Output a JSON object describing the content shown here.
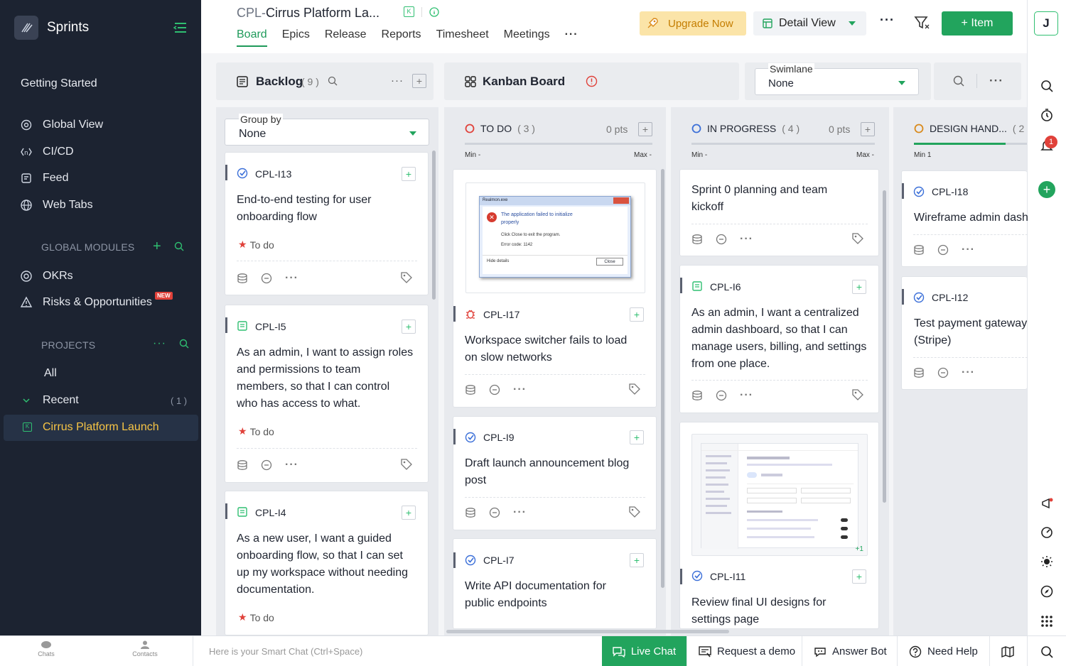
{
  "sidebar": {
    "brand": "Sprints",
    "getting_started": "Getting Started",
    "items": [
      {
        "label": "Global View",
        "icon": "eye-icon"
      },
      {
        "label": "CI/CD",
        "icon": "code-icon"
      },
      {
        "label": "Feed",
        "icon": "feed-icon"
      },
      {
        "label": "Web Tabs",
        "icon": "globe-icon"
      }
    ],
    "global_modules_label": "GLOBAL MODULES",
    "modules": [
      {
        "label": "OKRs",
        "icon": "target-icon"
      },
      {
        "label": "Risks & Opportunities",
        "icon": "warning-icon",
        "badge": "NEW"
      }
    ],
    "projects_label": "PROJECTS",
    "all": "All",
    "recent": "Recent",
    "recent_count": "( 1 )",
    "active_project": "Cirrus Platform Launch",
    "active_project_key": "K"
  },
  "header": {
    "title_prefix": "CPL-",
    "title": "Cirrus Platform La...",
    "tabs": [
      "Board",
      "Epics",
      "Release",
      "Reports",
      "Timesheet",
      "Meetings"
    ],
    "active_tab": "Board",
    "upgrade": "Upgrade Now",
    "view": "Detail View",
    "add_item": "+ Item"
  },
  "backlog": {
    "title": "Backlog",
    "count": "( 9 )",
    "group_by_label": "Group by",
    "group_by_value": "None",
    "cards": [
      {
        "id": "CPL-I13",
        "title_lines": [
          "End-to-end testing for user",
          "onboarding flow"
        ],
        "status": "To do",
        "type": "task"
      },
      {
        "id": "CPL-I5",
        "title_lines": [
          "As an admin, I want to assign roles",
          "and permissions to team",
          "members, so that I can control",
          "who has access to what."
        ],
        "status": "To do",
        "type": "story"
      },
      {
        "id": "CPL-I4",
        "title_lines": [
          "As a new user, I want a guided",
          "onboarding flow, so that I can set",
          "up my workspace without needing",
          "documentation."
        ],
        "status": "To do",
        "type": "story"
      }
    ]
  },
  "kanban": {
    "title": "Kanban Board",
    "swimlane_label": "Swimlane",
    "swimlane_value": "None",
    "columns": [
      {
        "name": "TO DO",
        "count": "( 3 )",
        "pts": "0 pts",
        "min": "Min -",
        "max": "Max -",
        "color": "#e0413a"
      },
      {
        "name": "IN PROGRESS",
        "count": "( 4 )",
        "pts": "0 pts",
        "min": "Min -",
        "max": "Max -",
        "color": "#3b6fd8"
      },
      {
        "name": "DESIGN HAND...",
        "count": "( 2",
        "pts": "",
        "min": "Min 1",
        "max": "",
        "color": "#d98a1c"
      }
    ],
    "todo_cards": [
      {
        "id": "CPL-I17",
        "title_lines": [
          "Workspace switcher fails to load",
          "on slow networks"
        ],
        "type": "bug",
        "thumb": {
          "window_title": "Realmon.exe",
          "line1": "The application failed to initialize",
          "line2": "properly",
          "line3": "Click Close to exit the program.",
          "line4": "Error code: 1142",
          "hide": "Hide details",
          "close": "Close"
        }
      },
      {
        "id": "CPL-I9",
        "title_lines": [
          "Draft launch announcement blog",
          "post"
        ],
        "type": "task"
      },
      {
        "id": "CPL-I7",
        "title_lines": [
          "Write API documentation for",
          "public endpoints"
        ],
        "type": "task"
      }
    ],
    "progress_cards": [
      {
        "id": "",
        "title_lines": [
          "Sprint 0 planning and team",
          "kickoff"
        ],
        "type": "task"
      },
      {
        "id": "CPL-I6",
        "title_lines": [
          "As an admin, I want a centralized",
          "admin dashboard, so that I can",
          "manage users, billing, and settings",
          "from one place."
        ],
        "type": "story"
      },
      {
        "id": "CPL-I11",
        "title_lines": [
          "Review final UI designs for",
          "settings page"
        ],
        "type": "task",
        "extra": "+1"
      }
    ],
    "design_cards": [
      {
        "id": "CPL-I18",
        "title_lines": [
          "Wireframe admin dash"
        ],
        "type": "task"
      },
      {
        "id": "CPL-I12",
        "title_lines": [
          "Test payment gateway",
          "(Stripe)"
        ],
        "type": "task"
      }
    ]
  },
  "rail": {
    "avatar": "J",
    "notif_count": "1"
  },
  "bottom": {
    "chats": "Chats",
    "contacts": "Contacts",
    "smart_chat_placeholder": "Here is your Smart Chat (Ctrl+Space)",
    "live_chat": "Live Chat",
    "request_demo": "Request a demo",
    "answer_bot": "Answer Bot",
    "need_help": "Need Help"
  },
  "colors": {
    "accent": "#22a45d",
    "sidebar": "#1c2331",
    "active_project": "#f6c445",
    "upgrade_bg": "#fbe4a8",
    "upgrade_fg": "#c47d00"
  }
}
